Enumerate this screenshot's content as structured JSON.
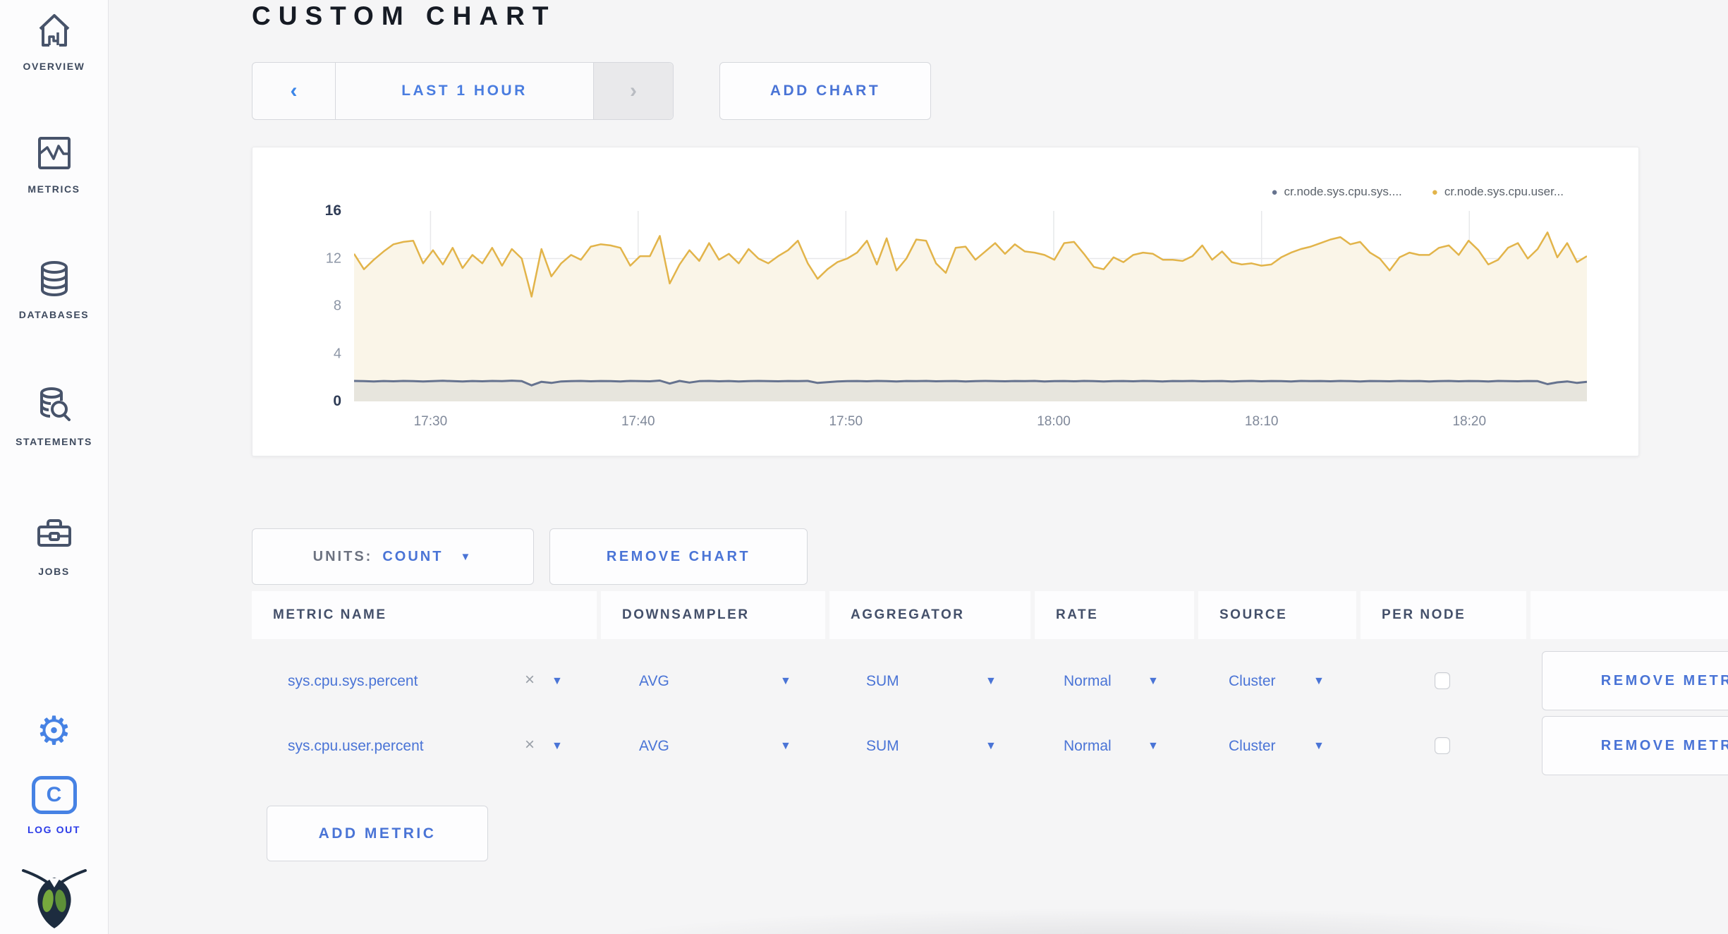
{
  "sidebar": {
    "items": [
      {
        "label": "OVERVIEW",
        "icon": "home-chart-icon"
      },
      {
        "label": "METRICS",
        "icon": "graph-icon"
      },
      {
        "label": "DATABASES",
        "icon": "database-icon"
      },
      {
        "label": "STATEMENTS",
        "icon": "database-search-icon"
      },
      {
        "label": "JOBS",
        "icon": "briefcase-icon"
      }
    ],
    "logout_label": "LOG OUT",
    "logo_letter": "C"
  },
  "header": {
    "title": "CUSTOM CHART"
  },
  "toolbar": {
    "time_range": "LAST 1 HOUR",
    "add_chart": "ADD CHART"
  },
  "controls": {
    "units_label": "UNITS:",
    "units_value": "COUNT",
    "remove_chart": "REMOVE CHART",
    "add_metric": "ADD METRIC"
  },
  "icons": {
    "close": "×",
    "caret": "▼",
    "prev": "‹",
    "next": "›",
    "dot": "●",
    "gear": "⚙"
  },
  "chart_data": {
    "type": "line",
    "area": true,
    "ylim": [
      0,
      16
    ],
    "yticks": [
      0,
      4,
      8,
      12,
      16
    ],
    "x_tick_labels": [
      "17:30",
      "17:40",
      "17:50",
      "18:00",
      "18:10",
      "18:20"
    ],
    "x_tick_fracs": [
      0.062,
      0.2304,
      0.3989,
      0.5675,
      0.7361,
      0.9046
    ],
    "grid": true,
    "legend_position": "top-right",
    "series": [
      {
        "name": "cr.node.sys.cpu.sys....",
        "color": "#66738f",
        "fill": "rgba(109,121,143,0.13)",
        "line_width": 3,
        "values": [
          1.72,
          1.7,
          1.68,
          1.71,
          1.69,
          1.72,
          1.7,
          1.67,
          1.7,
          1.73,
          1.7,
          1.68,
          1.71,
          1.69,
          1.72,
          1.7,
          1.74,
          1.7,
          1.35,
          1.65,
          1.55,
          1.68,
          1.7,
          1.72,
          1.69,
          1.71,
          1.7,
          1.68,
          1.72,
          1.7,
          1.69,
          1.75,
          1.5,
          1.72,
          1.58,
          1.7,
          1.72,
          1.69,
          1.71,
          1.68,
          1.7,
          1.72,
          1.7,
          1.69,
          1.71,
          1.7,
          1.72,
          1.55,
          1.62,
          1.68,
          1.7,
          1.71,
          1.69,
          1.72,
          1.7,
          1.68,
          1.71,
          1.7,
          1.72,
          1.69,
          1.7,
          1.71,
          1.68,
          1.7,
          1.72,
          1.7,
          1.69,
          1.71,
          1.7,
          1.72,
          1.68,
          1.7,
          1.71,
          1.69,
          1.72,
          1.7,
          1.68,
          1.7,
          1.71,
          1.69,
          1.72,
          1.7,
          1.68,
          1.71,
          1.7,
          1.72,
          1.69,
          1.7,
          1.71,
          1.68,
          1.7,
          1.72,
          1.69,
          1.71,
          1.7,
          1.68,
          1.72,
          1.7,
          1.71,
          1.69,
          1.72,
          1.7,
          1.68,
          1.71,
          1.7,
          1.69,
          1.72,
          1.7,
          1.71,
          1.68,
          1.7,
          1.72,
          1.69,
          1.71,
          1.7,
          1.68,
          1.72,
          1.7,
          1.69,
          1.71,
          1.7,
          1.45,
          1.6,
          1.68,
          1.55,
          1.65
        ]
      },
      {
        "name": "cr.node.sys.cpu.user...",
        "color": "#e2b44a",
        "fill": "#faf5e8",
        "line_width": 2.5,
        "values": [
          12.4,
          11.1,
          11.9,
          12.6,
          13.2,
          13.4,
          13.5,
          11.6,
          12.7,
          11.5,
          12.9,
          11.2,
          12.3,
          11.6,
          12.9,
          11.4,
          12.8,
          12.0,
          8.8,
          12.8,
          10.5,
          11.6,
          12.3,
          11.9,
          13.0,
          13.2,
          13.1,
          12.9,
          11.4,
          12.2,
          12.2,
          13.9,
          9.9,
          11.5,
          12.7,
          11.8,
          13.3,
          11.9,
          12.4,
          11.6,
          12.8,
          12.0,
          11.6,
          12.2,
          12.7,
          13.5,
          11.6,
          10.3,
          11.1,
          11.7,
          12.0,
          12.5,
          13.5,
          11.5,
          13.7,
          11.0,
          12.0,
          13.6,
          13.5,
          11.6,
          10.8,
          12.9,
          13.0,
          11.9,
          12.6,
          13.3,
          12.4,
          13.2,
          12.6,
          12.5,
          12.3,
          11.9,
          13.3,
          13.4,
          12.4,
          11.3,
          11.1,
          12.1,
          11.7,
          12.3,
          12.5,
          12.4,
          11.9,
          11.9,
          11.8,
          12.2,
          13.1,
          11.9,
          12.6,
          11.7,
          11.5,
          11.6,
          11.4,
          11.5,
          12.1,
          12.5,
          12.8,
          13.0,
          13.3,
          13.6,
          13.8,
          13.2,
          13.4,
          12.5,
          12.0,
          11.0,
          12.1,
          12.5,
          12.3,
          12.3,
          12.9,
          13.1,
          12.3,
          13.5,
          12.7,
          11.5,
          11.9,
          12.9,
          13.3,
          12.0,
          12.8,
          14.2,
          12.1,
          13.3,
          11.7,
          12.2
        ]
      }
    ]
  },
  "table": {
    "headers": [
      "METRIC NAME",
      "DOWNSAMPLER",
      "AGGREGATOR",
      "RATE",
      "SOURCE",
      "PER NODE",
      ""
    ],
    "rows": [
      {
        "metric": "sys.cpu.sys.percent",
        "downsampler": "AVG",
        "aggregator": "SUM",
        "rate": "Normal",
        "source": "Cluster",
        "per_node_checked": false,
        "remove_label": "REMOVE METRIC"
      },
      {
        "metric": "sys.cpu.user.percent",
        "downsampler": "AVG",
        "aggregator": "SUM",
        "rate": "Normal",
        "source": "Cluster",
        "per_node_checked": false,
        "remove_label": "REMOVE METRIC"
      }
    ]
  }
}
